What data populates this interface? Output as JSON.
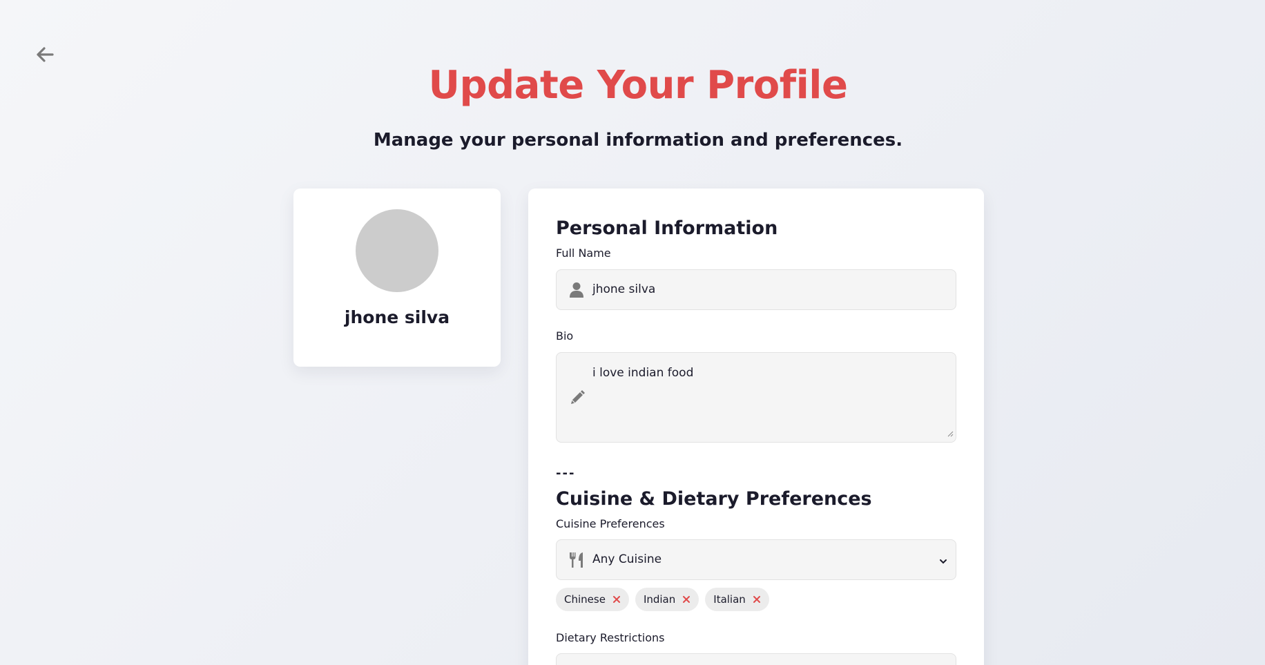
{
  "header": {
    "title": "Update Your Profile",
    "subtitle": "Manage your personal information and preferences."
  },
  "icons": {
    "back": "arrow-left-icon",
    "user": "user-icon",
    "bio": "pencil-icon",
    "cuisine": "utensils-icon",
    "dropdown": "chevron-down-icon",
    "remove": "close-icon"
  },
  "colors": {
    "accent": "#e04a4a",
    "text": "#1b1b2b",
    "icon": "#7a7a7a",
    "avatar": "#cccccc",
    "field_bg": "#f5f5f5"
  },
  "profile_card": {
    "name": "jhone silva"
  },
  "personal": {
    "section_title": "Personal Information",
    "full_name_label": "Full Name",
    "full_name_value": "jhone silva",
    "bio_label": "Bio",
    "bio_value": "i love indian food"
  },
  "divider_text": "---",
  "cuisine": {
    "section_title": "Cuisine & Dietary Preferences",
    "preferences_label": "Cuisine Preferences",
    "selected_option": "Any Cuisine",
    "chips": [
      "Chinese",
      "Indian",
      "Italian"
    ],
    "dietary_label": "Dietary Restrictions"
  }
}
